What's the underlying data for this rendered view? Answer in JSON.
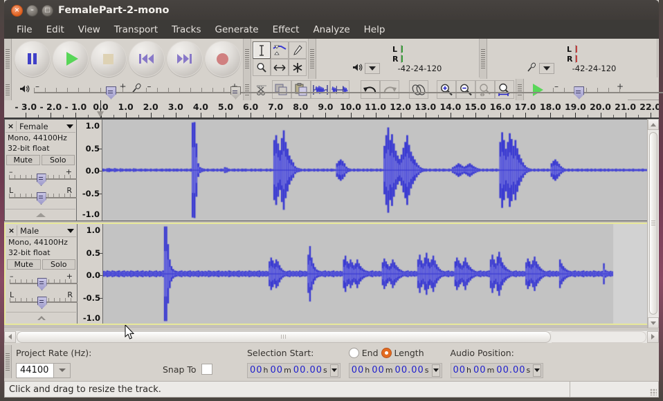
{
  "window": {
    "title": "FemalePart-2-mono",
    "close_label": "×",
    "minimize_label": "–",
    "maximize_label": "□"
  },
  "menubar": {
    "items": [
      {
        "label": "File"
      },
      {
        "label": "Edit"
      },
      {
        "label": "View"
      },
      {
        "label": "Transport"
      },
      {
        "label": "Tracks"
      },
      {
        "label": "Generate"
      },
      {
        "label": "Effect"
      },
      {
        "label": "Analyze"
      },
      {
        "label": "Help"
      }
    ]
  },
  "transport": {
    "buttons": [
      {
        "name": "pause",
        "icon": "pause-icon"
      },
      {
        "name": "play",
        "icon": "play-icon"
      },
      {
        "name": "stop",
        "icon": "stop-icon"
      },
      {
        "name": "skip-to-start",
        "icon": "skip-start-icon"
      },
      {
        "name": "skip-to-end",
        "icon": "skip-end-icon"
      },
      {
        "name": "record",
        "icon": "record-icon"
      }
    ]
  },
  "tools": [
    {
      "name": "selection-tool",
      "icon": "i-beam-icon",
      "selected": true
    },
    {
      "name": "envelope-tool",
      "icon": "envelope-icon",
      "selected": false
    },
    {
      "name": "draw-tool",
      "icon": "pencil-icon",
      "selected": false
    },
    {
      "name": "zoom-tool",
      "icon": "magnifier-icon",
      "selected": false
    },
    {
      "name": "timeshift-tool",
      "icon": "double-arrow-icon",
      "selected": false
    },
    {
      "name": "multi-tool",
      "icon": "asterisk-icon",
      "selected": false
    }
  ],
  "meters": {
    "output": {
      "channels": [
        "L",
        "R"
      ],
      "scale": [
        "-42",
        "-24",
        "-12",
        "0"
      ],
      "icon": "speaker-icon"
    },
    "input": {
      "channels": [
        "L",
        "R"
      ],
      "scale": [
        "-42",
        "-24",
        "-12",
        "0"
      ],
      "icon": "microphone-icon"
    }
  },
  "mixer": {
    "output_icon": "speaker-icon",
    "input_icon": "microphone-icon"
  },
  "edit_toolbar": [
    {
      "name": "cut",
      "icon": "scissors-icon"
    },
    {
      "name": "copy",
      "icon": "copy-icon"
    },
    {
      "name": "paste",
      "icon": "paste-icon"
    },
    {
      "name": "trim-audio-outside-selection",
      "icon": "trim-icon"
    },
    {
      "name": "silence-audio-selection",
      "icon": "silence-icon"
    },
    {
      "name": "undo",
      "icon": "undo-icon"
    },
    {
      "name": "redo",
      "icon": "redo-icon"
    },
    {
      "name": "sync-lock-tracks",
      "icon": "link-icon"
    },
    {
      "name": "zoom-in",
      "icon": "zoom-in-icon"
    },
    {
      "name": "zoom-out",
      "icon": "zoom-out-icon"
    },
    {
      "name": "fit-selection-in-window",
      "icon": "fit-selection-icon"
    },
    {
      "name": "fit-project-in-window",
      "icon": "fit-project-icon"
    },
    {
      "name": "play-at-speed",
      "icon": "play-speed-icon"
    }
  ],
  "ruler": {
    "unit": "seconds",
    "labels": [
      "- 3.0",
      "- 2.0",
      "- 1.0",
      "0.0",
      "1.0",
      "2.0",
      "3.0",
      "4.0",
      "5.0",
      "6.0",
      "7.0",
      "8.0",
      "9.0",
      "10.0",
      "11.0",
      "12.0",
      "13.0",
      "14.0",
      "15.0",
      "16.0",
      "17.0",
      "18.0",
      "19.0",
      "20.0",
      "21.0",
      "22.0"
    ],
    "values": [
      -3,
      -2,
      -1,
      0,
      1,
      2,
      3,
      4,
      5,
      6,
      7,
      8,
      9,
      10,
      11,
      12,
      13,
      14,
      15,
      16,
      17,
      18,
      19,
      20,
      21,
      22
    ],
    "playhead_time": "0.0"
  },
  "tracks": [
    {
      "name": "Female",
      "close_label": "×",
      "info_line1": "Mono, 44100Hz",
      "info_line2": "32-bit float",
      "mute_label": "Mute",
      "solo_label": "Solo",
      "gain_minus": "–",
      "gain_plus": "+",
      "pan_left": "L",
      "pan_right": "R",
      "vruler_labels": [
        "1.0",
        "0.5",
        "0.0",
        "-0.5",
        "-1.0"
      ],
      "vruler_values": [
        1.0,
        0.5,
        0.0,
        -0.5,
        -1.0
      ],
      "selected": false,
      "collapse_icon": "triangle-up-filled-icon"
    },
    {
      "name": "Male",
      "close_label": "×",
      "info_line1": "Mono, 44100Hz",
      "info_line2": "32-bit float",
      "mute_label": "Mute",
      "solo_label": "Solo",
      "gain_minus": "–",
      "gain_plus": "+",
      "pan_left": "L",
      "pan_right": "R",
      "vruler_labels": [
        "1.0",
        "0.5",
        "0.0",
        "-0.5",
        "-1.0"
      ],
      "vruler_values": [
        1.0,
        0.5,
        0.0,
        -0.5,
        -1.0
      ],
      "selected": true,
      "collapse_icon": "triangle-up-outline-icon"
    }
  ],
  "waveform": {
    "color_peak": "#3a3ad2",
    "color_rms": "#6f6fe0",
    "background": "#c3c3c3",
    "background_past_end": "#d2d2d2",
    "track1_peaks": [
      0.03,
      0.02,
      0.035,
      0.04,
      0.03,
      0.025,
      0.04,
      0.03,
      0.02,
      0.035,
      0.03,
      0.02,
      0.03,
      0.025,
      0.03,
      0.02,
      0.035,
      0.03,
      0.02,
      0.025,
      0.03,
      0.02,
      0.03,
      0.025,
      0.02,
      0.03,
      0.02,
      0.025,
      0.03,
      0.02,
      0.025,
      0.03,
      0.02,
      0.03,
      0.025,
      0.03,
      0.02,
      0.03,
      0.025,
      0.03,
      0.02,
      0.03,
      0.02,
      0.025,
      0.03,
      0.02,
      0.03,
      0.98,
      0.99,
      0.55,
      0.14,
      0.06,
      0.04,
      0.03,
      0.02,
      0.03,
      0.02,
      0.025,
      0.03,
      0.02,
      0.03,
      0.02,
      0.03,
      0.025,
      0.06,
      0.05,
      0.03,
      0.02,
      0.025,
      0.03,
      0.02,
      0.03,
      0.02,
      0.03,
      0.025,
      0.03,
      0.02,
      0.02,
      0.03,
      0.02,
      0.03,
      0.02,
      0.025,
      0.03,
      0.02,
      0.02,
      0.03,
      0.02,
      0.03,
      0.02,
      0.62,
      0.72,
      0.55,
      0.41,
      0.66,
      0.82,
      0.58,
      0.44,
      0.3,
      0.22,
      0.16,
      0.08,
      0.05,
      0.04,
      0.03,
      0.02,
      0.03,
      0.02,
      0.03,
      0.025,
      0.02,
      0.03,
      0.02,
      0.03,
      0.02,
      0.025,
      0.03,
      0.02,
      0.03,
      0.02,
      0.03,
      0.025,
      0.02,
      0.14,
      0.19,
      0.22,
      0.19,
      0.14,
      0.07,
      0.04,
      0.03,
      0.02,
      0.03,
      0.02,
      0.03,
      0.025,
      0.02,
      0.03,
      0.02,
      0.03,
      0.02,
      0.03,
      0.025,
      0.02,
      0.03,
      0.02,
      0.03,
      0.02,
      0.5,
      0.72,
      0.88,
      0.62,
      0.74,
      0.55,
      0.4,
      0.3,
      0.23,
      0.32,
      0.46,
      0.58,
      0.72,
      0.52,
      0.38,
      0.29,
      0.22,
      0.15,
      0.1,
      0.06,
      0.04,
      0.03,
      0.03,
      0.02,
      0.03,
      0.02,
      0.025,
      0.03,
      0.02,
      0.03,
      0.02,
      0.03,
      0.025,
      0.02,
      0.03,
      0.02,
      0.06,
      0.08,
      0.11,
      0.14,
      0.12,
      0.09,
      0.07,
      0.09,
      0.12,
      0.14,
      0.11,
      0.08,
      0.06,
      0.04,
      0.03,
      0.02,
      0.03,
      0.02,
      0.03,
      0.02,
      0.025,
      0.03,
      0.02,
      0.03,
      0.02,
      0.58,
      0.78,
      0.62,
      0.44,
      0.58,
      0.76,
      0.64,
      0.5,
      0.62,
      0.45,
      0.32,
      0.24,
      0.16,
      0.1,
      0.06,
      0.04,
      0.03,
      0.02,
      0.03,
      0.02,
      0.03,
      0.02,
      0.025,
      0.03,
      0.02,
      0.03,
      0.02,
      0.14,
      0.19,
      0.22,
      0.18,
      0.13,
      0.08,
      0.05,
      0.03,
      0.02,
      0.03,
      0.02,
      0.03,
      0.02,
      0.025,
      0.03,
      0.02,
      0.03,
      0.02,
      0.025,
      0.03,
      0.02,
      0.03,
      0.02,
      0.03,
      0.02,
      0.025,
      0.03,
      0.02,
      0.03,
      0.02,
      0.03,
      0.02,
      0.025,
      0.02,
      0.03,
      0.02,
      0.025,
      0.02,
      0.03,
      0.02,
      0.02,
      0.025,
      0.02,
      0.03,
      0.02,
      0.02,
      0.025,
      0.02,
      0.03,
      0.02,
      0.02,
      0.025,
      0.02
    ],
    "track2_peaks": [
      0.06,
      0.05,
      0.07,
      0.06,
      0.05,
      0.07,
      0.06,
      0.05,
      0.06,
      0.07,
      0.05,
      0.06,
      0.07,
      0.05,
      0.06,
      0.05,
      0.07,
      0.06,
      0.05,
      0.06,
      0.07,
      0.05,
      0.06,
      0.07,
      0.05,
      0.06,
      0.05,
      0.07,
      0.06,
      0.05,
      0.06,
      0.07,
      0.05,
      0.06,
      0.05,
      0.07,
      0.99,
      0.99,
      0.62,
      0.3,
      0.16,
      0.1,
      0.07,
      0.06,
      0.05,
      0.06,
      0.07,
      0.05,
      0.06,
      0.05,
      0.06,
      0.07,
      0.05,
      0.06,
      0.05,
      0.06,
      0.07,
      0.05,
      0.06,
      0.05,
      0.06,
      0.05,
      0.07,
      0.06,
      0.05,
      0.06,
      0.05,
      0.06,
      0.07,
      0.05,
      0.06,
      0.05,
      0.06,
      0.05,
      0.07,
      0.06,
      0.05,
      0.06,
      0.05,
      0.06,
      0.07,
      0.05,
      0.06,
      0.05,
      0.06,
      0.05,
      0.07,
      0.06,
      0.05,
      0.06,
      0.05,
      0.06,
      0.07,
      0.05,
      0.06,
      0.05,
      0.06,
      0.05,
      0.26,
      0.34,
      0.28,
      0.22,
      0.3,
      0.26,
      0.18,
      0.12,
      0.08,
      0.06,
      0.05,
      0.06,
      0.07,
      0.05,
      0.06,
      0.05,
      0.06,
      0.05,
      0.07,
      0.06,
      0.05,
      0.06,
      0.05,
      0.4,
      0.58,
      0.34,
      0.22,
      0.14,
      0.09,
      0.07,
      0.06,
      0.05,
      0.06,
      0.07,
      0.05,
      0.06,
      0.05,
      0.06,
      0.07,
      0.05,
      0.06,
      0.05,
      0.06,
      0.05,
      0.3,
      0.38,
      0.26,
      0.22,
      0.3,
      0.24,
      0.18,
      0.22,
      0.3,
      0.22,
      0.16,
      0.12,
      0.09,
      0.07,
      0.06,
      0.05,
      0.06,
      0.07,
      0.05,
      0.06,
      0.05,
      0.06,
      0.05,
      0.24,
      0.32,
      0.26,
      0.2,
      0.16,
      0.22,
      0.3,
      0.24,
      0.18,
      0.14,
      0.1,
      0.08,
      0.06,
      0.05,
      0.06,
      0.07,
      0.05,
      0.06,
      0.05,
      0.06,
      0.05,
      0.3,
      0.4,
      0.28,
      0.22,
      0.34,
      0.44,
      0.32,
      0.24,
      0.3,
      0.38,
      0.28,
      0.2,
      0.14,
      0.1,
      0.07,
      0.06,
      0.05,
      0.06,
      0.07,
      0.05,
      0.06,
      0.05,
      0.26,
      0.34,
      0.28,
      0.22,
      0.18,
      0.26,
      0.34,
      0.24,
      0.18,
      0.14,
      0.1,
      0.08,
      0.06,
      0.05,
      0.06,
      0.07,
      0.05,
      0.06,
      0.05,
      0.06,
      0.07,
      0.3,
      0.4,
      0.3,
      0.22,
      0.36,
      0.46,
      0.34,
      0.24,
      0.18,
      0.14,
      0.1,
      0.08,
      0.06,
      0.05,
      0.06,
      0.07,
      0.05,
      0.06,
      0.05,
      0.06,
      0.05,
      0.24,
      0.32,
      0.26,
      0.2,
      0.28,
      0.36,
      0.26,
      0.2,
      0.15,
      0.11,
      0.08,
      0.06,
      0.05,
      0.06,
      0.07,
      0.05,
      0.06,
      0.05,
      0.06,
      0.05,
      0.3,
      0.22,
      0.16,
      0.12,
      0.09,
      0.07,
      0.06,
      0.05,
      0.06,
      0.07,
      0.05,
      0.06,
      0.05,
      0.06,
      0.07,
      0.05,
      0.06,
      0.05,
      0.06,
      0.05,
      0.07,
      0.06,
      0.05,
      0.06,
      0.05,
      0.06,
      0.22,
      0.08,
      0.06,
      0.05,
      0.06,
      0.05
    ]
  },
  "selection_bar": {
    "project_rate_label": "Project Rate (Hz):",
    "project_rate_value": "44100",
    "snap_to_label": "Snap To",
    "snap_to_checked": false,
    "selection_start_label": "Selection Start:",
    "end_label": "End",
    "length_label": "Length",
    "end_selected": false,
    "length_selected": true,
    "audio_position_label": "Audio Position:",
    "time_fields": [
      {
        "name": "selection-start",
        "digits": [
          "00",
          "00",
          "00.00"
        ],
        "units": [
          "h",
          "m",
          "s"
        ]
      },
      {
        "name": "selection-length",
        "digits": [
          "00",
          "00",
          "00.00"
        ],
        "units": [
          "h",
          "m",
          "s"
        ]
      },
      {
        "name": "audio-position",
        "digits": [
          "00",
          "00",
          "00.00"
        ],
        "units": [
          "h",
          "m",
          "s"
        ]
      }
    ]
  },
  "statusbar": {
    "message": "Click and drag to resize the track."
  },
  "colors": {
    "accent_orange": "#e36b20",
    "selection_yellow": "#e8e89a",
    "waveform_blue": "#3a3ad2",
    "titlebar": "#3f3b38",
    "panel_bg": "#d6d2cc"
  }
}
